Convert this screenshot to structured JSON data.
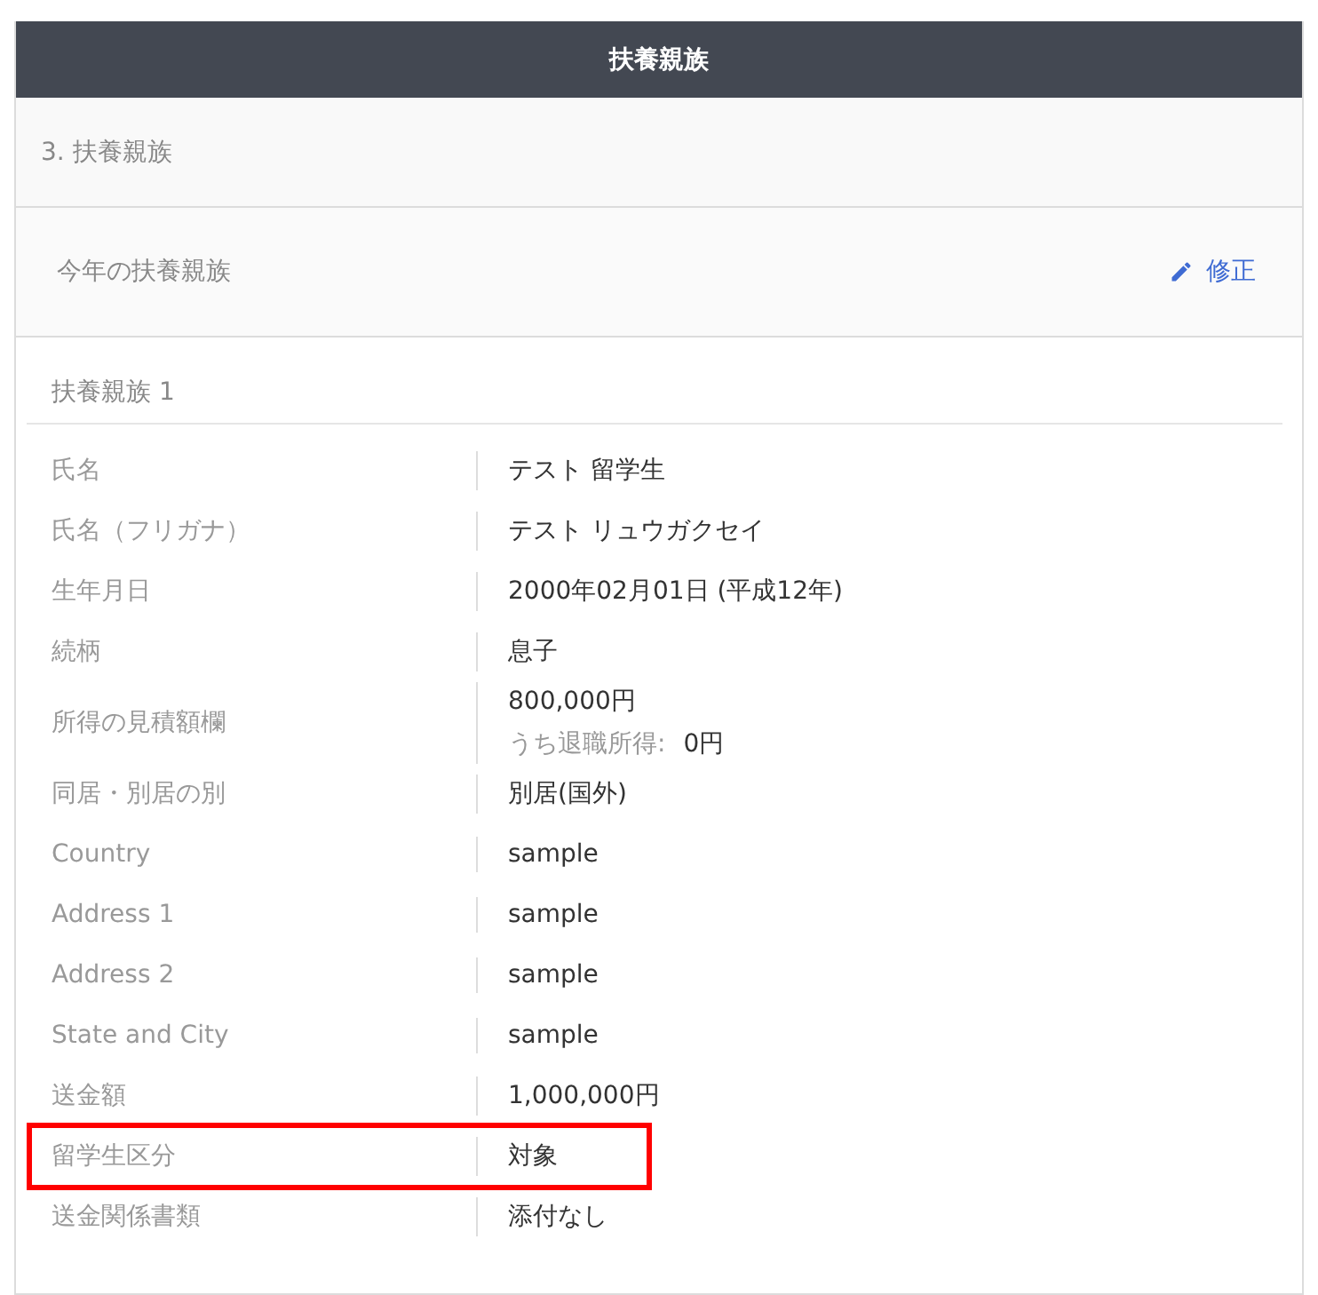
{
  "header": {
    "title": "扶養親族"
  },
  "section": {
    "title": "3. 扶養親族"
  },
  "subsection": {
    "title": "今年の扶養親族",
    "edit_link": "修正"
  },
  "dependent": {
    "title": "扶養親族 1",
    "rows": [
      {
        "label": "氏名",
        "value": "テスト 留学生",
        "highlighted": false
      },
      {
        "label": "氏名（フリガナ）",
        "value": "テスト リュウガクセイ",
        "highlighted": false
      },
      {
        "label": "生年月日",
        "value": "2000年02月01日 (平成12年)",
        "highlighted": false
      },
      {
        "label": "続柄",
        "value": "息子",
        "highlighted": false
      },
      {
        "label": "所得の見積額欄",
        "value": "800,000円",
        "note_label": "うち退職所得:",
        "note_value": "0円",
        "highlighted": false
      },
      {
        "label": "同居・別居の別",
        "value": "別居(国外)",
        "highlighted": false
      },
      {
        "label": "Country",
        "value": "sample",
        "highlighted": false
      },
      {
        "label": "Address 1",
        "value": "sample",
        "highlighted": false
      },
      {
        "label": "Address 2",
        "value": "sample",
        "highlighted": false
      },
      {
        "label": "State and City",
        "value": "sample",
        "highlighted": false
      },
      {
        "label": "送金額",
        "value": "1,000,000円",
        "highlighted": false
      },
      {
        "label": "留学生区分",
        "value": "対象",
        "highlighted": true
      },
      {
        "label": "送金関係書類",
        "value": "添付なし",
        "highlighted": false
      }
    ]
  }
}
